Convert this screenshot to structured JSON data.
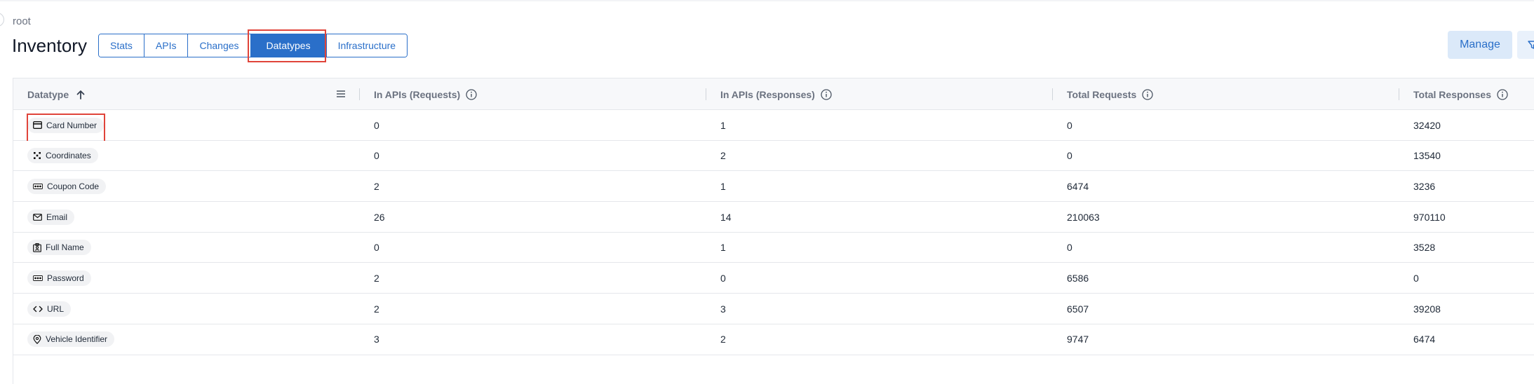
{
  "breadcrumb": "root",
  "title": "Inventory",
  "tabs": [
    {
      "label": "Stats",
      "active": false
    },
    {
      "label": "APIs",
      "active": false
    },
    {
      "label": "Changes",
      "active": false
    },
    {
      "label": "Datatypes",
      "active": true
    },
    {
      "label": "Infrastructure",
      "active": false
    }
  ],
  "manage_label": "Manage",
  "accent_color": "#2a6fc9",
  "highlight_color": "#e0443a",
  "table": {
    "columns": [
      {
        "label": "Datatype",
        "sort": "ascending"
      },
      {
        "label": "In APIs (Requests)",
        "info": true
      },
      {
        "label": "In APIs (Responses)",
        "info": true
      },
      {
        "label": "Total Requests",
        "info": true
      },
      {
        "label": "Total Responses",
        "info": true
      }
    ],
    "rows": [
      {
        "datatype": "Card Number",
        "icon": "credit-card-icon",
        "req_apis": "0",
        "resp_apis": "1",
        "total_req": "0",
        "total_resp": "32420"
      },
      {
        "datatype": "Coordinates",
        "icon": "coordinates-icon",
        "req_apis": "0",
        "resp_apis": "2",
        "total_req": "0",
        "total_resp": "13540"
      },
      {
        "datatype": "Coupon Code",
        "icon": "dots-icon",
        "req_apis": "2",
        "resp_apis": "1",
        "total_req": "6474",
        "total_resp": "3236"
      },
      {
        "datatype": "Email",
        "icon": "mail-icon",
        "req_apis": "26",
        "resp_apis": "14",
        "total_req": "210063",
        "total_resp": "970110"
      },
      {
        "datatype": "Full Name",
        "icon": "id-badge-icon",
        "req_apis": "0",
        "resp_apis": "1",
        "total_req": "0",
        "total_resp": "3528"
      },
      {
        "datatype": "Password",
        "icon": "dots-icon",
        "req_apis": "2",
        "resp_apis": "0",
        "total_req": "6586",
        "total_resp": "0"
      },
      {
        "datatype": "URL",
        "icon": "code-icon",
        "req_apis": "2",
        "resp_apis": "3",
        "total_req": "6507",
        "total_resp": "39208"
      },
      {
        "datatype": "Vehicle Identifier",
        "icon": "location-pin-icon",
        "req_apis": "3",
        "resp_apis": "2",
        "total_req": "9747",
        "total_resp": "6474"
      }
    ]
  }
}
